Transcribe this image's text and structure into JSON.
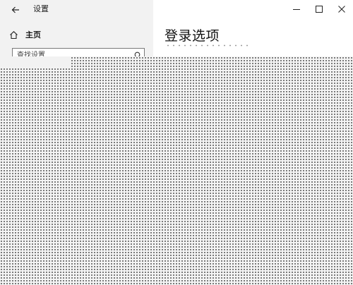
{
  "window": {
    "app_title": "设置",
    "page_title": "登录选项"
  },
  "sidebar": {
    "home_label": "主页",
    "search_placeholder": "查找设置"
  },
  "icons": {
    "back": "back-arrow-icon",
    "home": "home-icon",
    "search": "search-icon",
    "minimize": "minimize-icon",
    "maximize": "maximize-icon",
    "close": "close-icon"
  },
  "colors": {
    "sidebar_bg": "#f2f2f2",
    "content_bg": "#ffffff"
  }
}
